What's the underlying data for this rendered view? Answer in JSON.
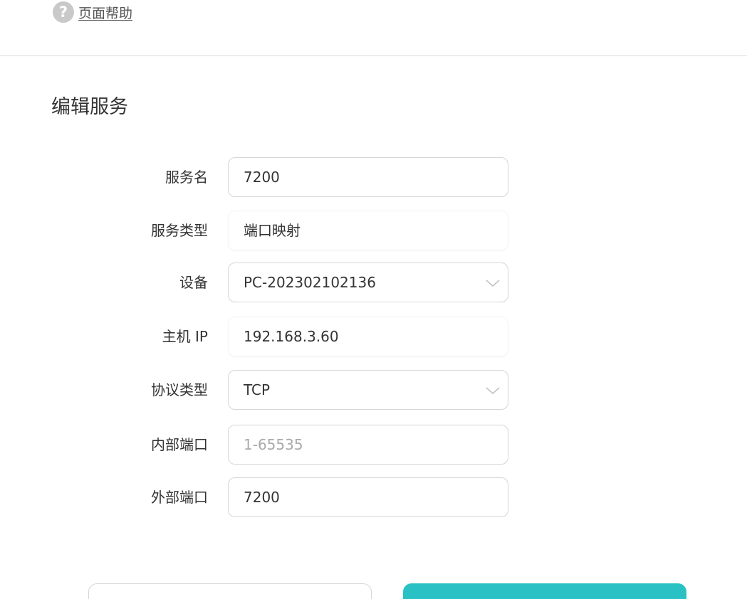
{
  "help": {
    "icon": "question-circle-icon",
    "label": "页面帮助"
  },
  "section": {
    "title": "编辑服务"
  },
  "form": {
    "service_name": {
      "label": "服务名",
      "value": "7200"
    },
    "service_type": {
      "label": "服务类型",
      "value": "端口映射"
    },
    "device": {
      "label": "设备",
      "value": "PC-202302102136",
      "icon": "chevron-down-icon"
    },
    "host_ip": {
      "label": "主机 IP",
      "value": "192.168.3.60"
    },
    "protocol": {
      "label": "协议类型",
      "value": "TCP",
      "icon": "chevron-down-icon"
    },
    "internal_port": {
      "label": "内部端口",
      "value": "",
      "placeholder": "1-65535"
    },
    "external_port": {
      "label": "外部端口",
      "value": "7200"
    }
  },
  "colors": {
    "accent": "#2ac1c4",
    "border": "#d6d6d6",
    "text": "#333333",
    "placeholder": "#a9a9a9"
  }
}
